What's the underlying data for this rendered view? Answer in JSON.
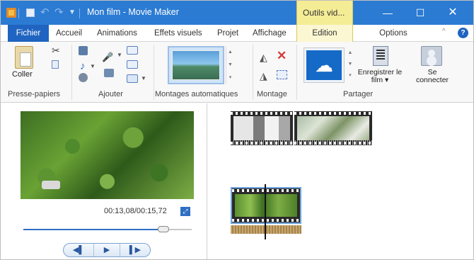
{
  "titlebar": {
    "title": "Mon film - Movie Maker",
    "context_group": "Outils vid...",
    "minimize": "—",
    "maximize": "☐",
    "close": "✕"
  },
  "tabs": {
    "fichier": "Fichier",
    "accueil": "Accueil",
    "animations": "Animations",
    "effets": "Effets visuels",
    "projet": "Projet",
    "affichage": "Affichage",
    "edition": "Edition",
    "options": "Options"
  },
  "ribbon": {
    "paste_label": "Coller",
    "groups": {
      "clipboard": "Presse-papiers",
      "add": "Ajouter",
      "automovie": "Montages automatiques",
      "editing": "Montage",
      "share": "Partager"
    },
    "save_movie_label": "Enregistrer le film ▾",
    "signin_label": "Se connecter"
  },
  "preview": {
    "timecode": "00:13,08/00:15,72",
    "progress": 0.83,
    "prev_frame": "◀▌",
    "play": "▶",
    "next_frame": "▌▶"
  },
  "icons": {
    "app": "moviemaker-icon",
    "onedrive": "onedrive-icon",
    "help": "?"
  },
  "colors": {
    "titlebar": "#2b7bd3",
    "file_tab": "#1f64c0",
    "context_tab": "#f5ec96",
    "accent": "#2f6fc4"
  }
}
